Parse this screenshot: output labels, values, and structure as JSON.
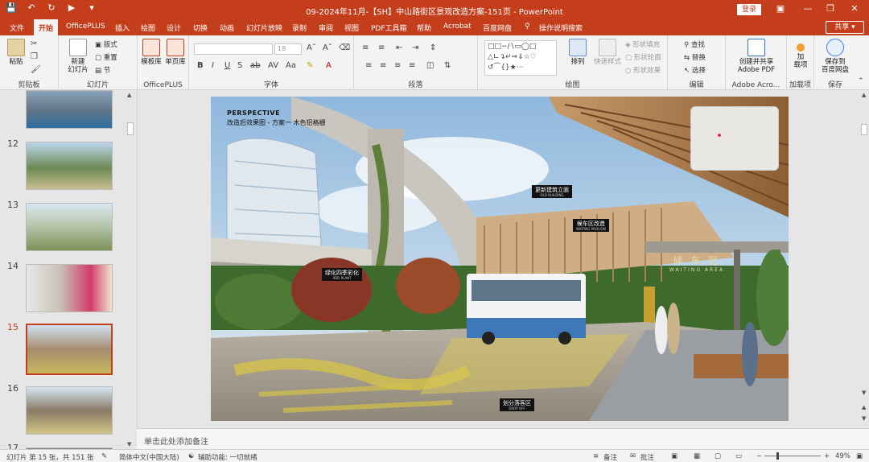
{
  "colors": {
    "accent": "#c43e1c",
    "ribbon": "#f3f3f3"
  },
  "titlebar": {
    "title": "09-2024年11月-【SH】中山路街区景观改造方案-151页 - PowerPoint",
    "login": "登录",
    "qat": [
      "save-icon",
      "undo-icon",
      "redo-icon",
      "present-icon",
      "customize-icon"
    ]
  },
  "tabs": {
    "items": [
      "文件",
      "开始",
      "OfficePLUS",
      "插入",
      "绘图",
      "设计",
      "切换",
      "动画",
      "幻灯片放映",
      "录制",
      "审阅",
      "视图",
      "PDF工具箱",
      "帮助",
      "Acrobat",
      "百度网盘"
    ],
    "search": "操作说明搜索",
    "share": "共享"
  },
  "ribbon": {
    "clipboard": {
      "paste": "粘贴",
      "label": "剪贴板"
    },
    "slides": {
      "new": "新建",
      "new2": "幻灯片",
      "layout": "版式",
      "reset": "重置",
      "section": "节",
      "label": "幻灯片"
    },
    "officeplus": {
      "template": "模板库",
      "single": "单页库",
      "label": "OfficePLUS"
    },
    "font": {
      "label": "字体",
      "size": "18"
    },
    "paragraph": {
      "label": "段落"
    },
    "drawing": {
      "arrange": "排列",
      "quickstyle": "快速样式",
      "fill": "形状填充",
      "outline": "形状轮廓",
      "effect": "形状效果",
      "label": "绘图"
    },
    "editing": {
      "find": "查找",
      "replace": "替换",
      "select": "选择",
      "label": "编辑"
    },
    "adobe": {
      "create1": "创建并共享",
      "create2": "Adobe PDF",
      "label": "Adobe Acro..."
    },
    "addins": {
      "add1": "加",
      "add2": "载项",
      "label": "加载项"
    },
    "save": {
      "s1": "保存到",
      "s2": "百度网盘",
      "label": "保存"
    }
  },
  "thumbnails": [
    {
      "num": "",
      "selected": false
    },
    {
      "num": "12",
      "selected": false
    },
    {
      "num": "13",
      "selected": false
    },
    {
      "num": "14",
      "selected": false
    },
    {
      "num": "15",
      "selected": true
    },
    {
      "num": "16",
      "selected": false
    },
    {
      "num": "17",
      "selected": false
    }
  ],
  "slide": {
    "perspective": "PERSPECTIVE",
    "subtitle": "改造后效果图 - 方案一 木色铝格栅",
    "callouts": [
      {
        "cn": "更新建筑立面",
        "en": "OLD BUILDING"
      },
      {
        "cn": "候车区改造",
        "en": "WAITING PAVILION"
      },
      {
        "cn": "绿化四季彩化",
        "en": "ADD PLANT"
      },
      {
        "cn": "划分落客区",
        "en": "DROP OFF"
      }
    ],
    "sign_cn": "候 车 区",
    "sign_en": "WAITING AREA"
  },
  "notes": "单击此处添加备注",
  "status": {
    "slide": "幻灯片 第 15 张，共 151 张",
    "lang": "简体中文(中国大陆)",
    "access": "辅助功能: 一切就绪",
    "notes": "备注",
    "comments": "批注",
    "zoom": "49%"
  }
}
